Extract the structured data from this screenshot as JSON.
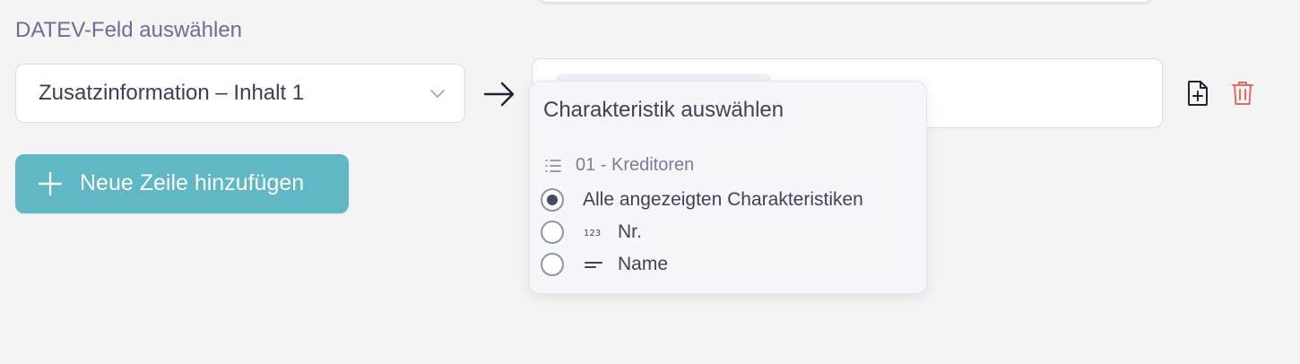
{
  "mapping": {
    "section_label": "DATEV-Feld auswählen",
    "datev_field": {
      "selected_value": "Zusatzinformation – Inhalt 1"
    }
  },
  "actions": {
    "add_row_label": "Neue Zeile hinzufügen"
  },
  "popover": {
    "title": "Charakteristik auswählen",
    "group_label": "01 - Kreditoren",
    "options": [
      {
        "label": "Alle angezeigten Charakteristiken",
        "checked": true,
        "icon": ""
      },
      {
        "label": "Nr.",
        "checked": false,
        "icon": "number-type-icon"
      },
      {
        "label": "Name",
        "checked": false,
        "icon": "text-type-icon"
      }
    ]
  },
  "colors": {
    "background": "#f4f4f4",
    "accent": "#5fb8c4",
    "danger": "#e26a6a",
    "label": "#6b6f93",
    "text": "#3b3f57"
  },
  "icons": {
    "chevron": "chevron-down-icon",
    "arrow": "arrow-right-icon",
    "file_add": "file-add-icon",
    "trash": "trash-icon",
    "plus": "plus-icon",
    "list": "list-icon"
  }
}
